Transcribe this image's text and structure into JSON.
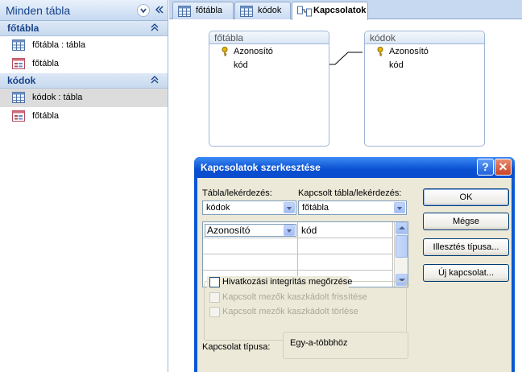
{
  "nav": {
    "title": "Minden tábla",
    "groups": [
      {
        "title": "főtábla",
        "items": [
          {
            "label": "főtábla : tábla",
            "icon": "table-icon"
          },
          {
            "label": "főtábla",
            "icon": "form-icon"
          }
        ]
      },
      {
        "title": "kódok",
        "items": [
          {
            "label": "kódok : tábla",
            "icon": "table-icon",
            "selected": true
          },
          {
            "label": "főtábla",
            "icon": "form-icon"
          }
        ]
      }
    ]
  },
  "tabs": [
    {
      "label": "főtábla",
      "icon": "table-icon"
    },
    {
      "label": "kódok",
      "icon": "table-icon"
    },
    {
      "label": "Kapcsolatok",
      "icon": "relationships-icon",
      "active": true
    }
  ],
  "relationship_tables": [
    {
      "name": "főtábla",
      "fields": [
        "Azonosító",
        "kód"
      ],
      "key_field": "Azonosító"
    },
    {
      "name": "kódok",
      "fields": [
        "Azonosító",
        "kód"
      ],
      "key_field": "Azonosító"
    }
  ],
  "dialog": {
    "title": "Kapcsolatok szerkesztése",
    "help_label": "?",
    "close_label": "✕",
    "table_label": "Tábla/lekérdezés:",
    "related_label": "Kapcsolt tábla/lekérdezés:",
    "table_value": "kódok",
    "related_value": "főtábla",
    "grid": {
      "left_field": "Azonosító",
      "right_field": "kód"
    },
    "buttons": {
      "ok": "OK",
      "cancel": "Mégse",
      "join_type": "Illesztés típusa...",
      "new_relation": "Új kapcsolat..."
    },
    "checkboxes": {
      "integrity": "Hivatkozási integritás megőrzése",
      "cascade_update": "Kapcsolt mezők kaszkádolt frissítése",
      "cascade_delete": "Kapcsolt mezők kaszkádolt törlése"
    },
    "relation_type_label": "Kapcsolat típusa:",
    "relation_type_value": "Egy-a-többhöz"
  },
  "colors": {
    "accent": "#15428b",
    "title_bar": "#0a57d4",
    "dialog_face": "#ece9d8"
  }
}
